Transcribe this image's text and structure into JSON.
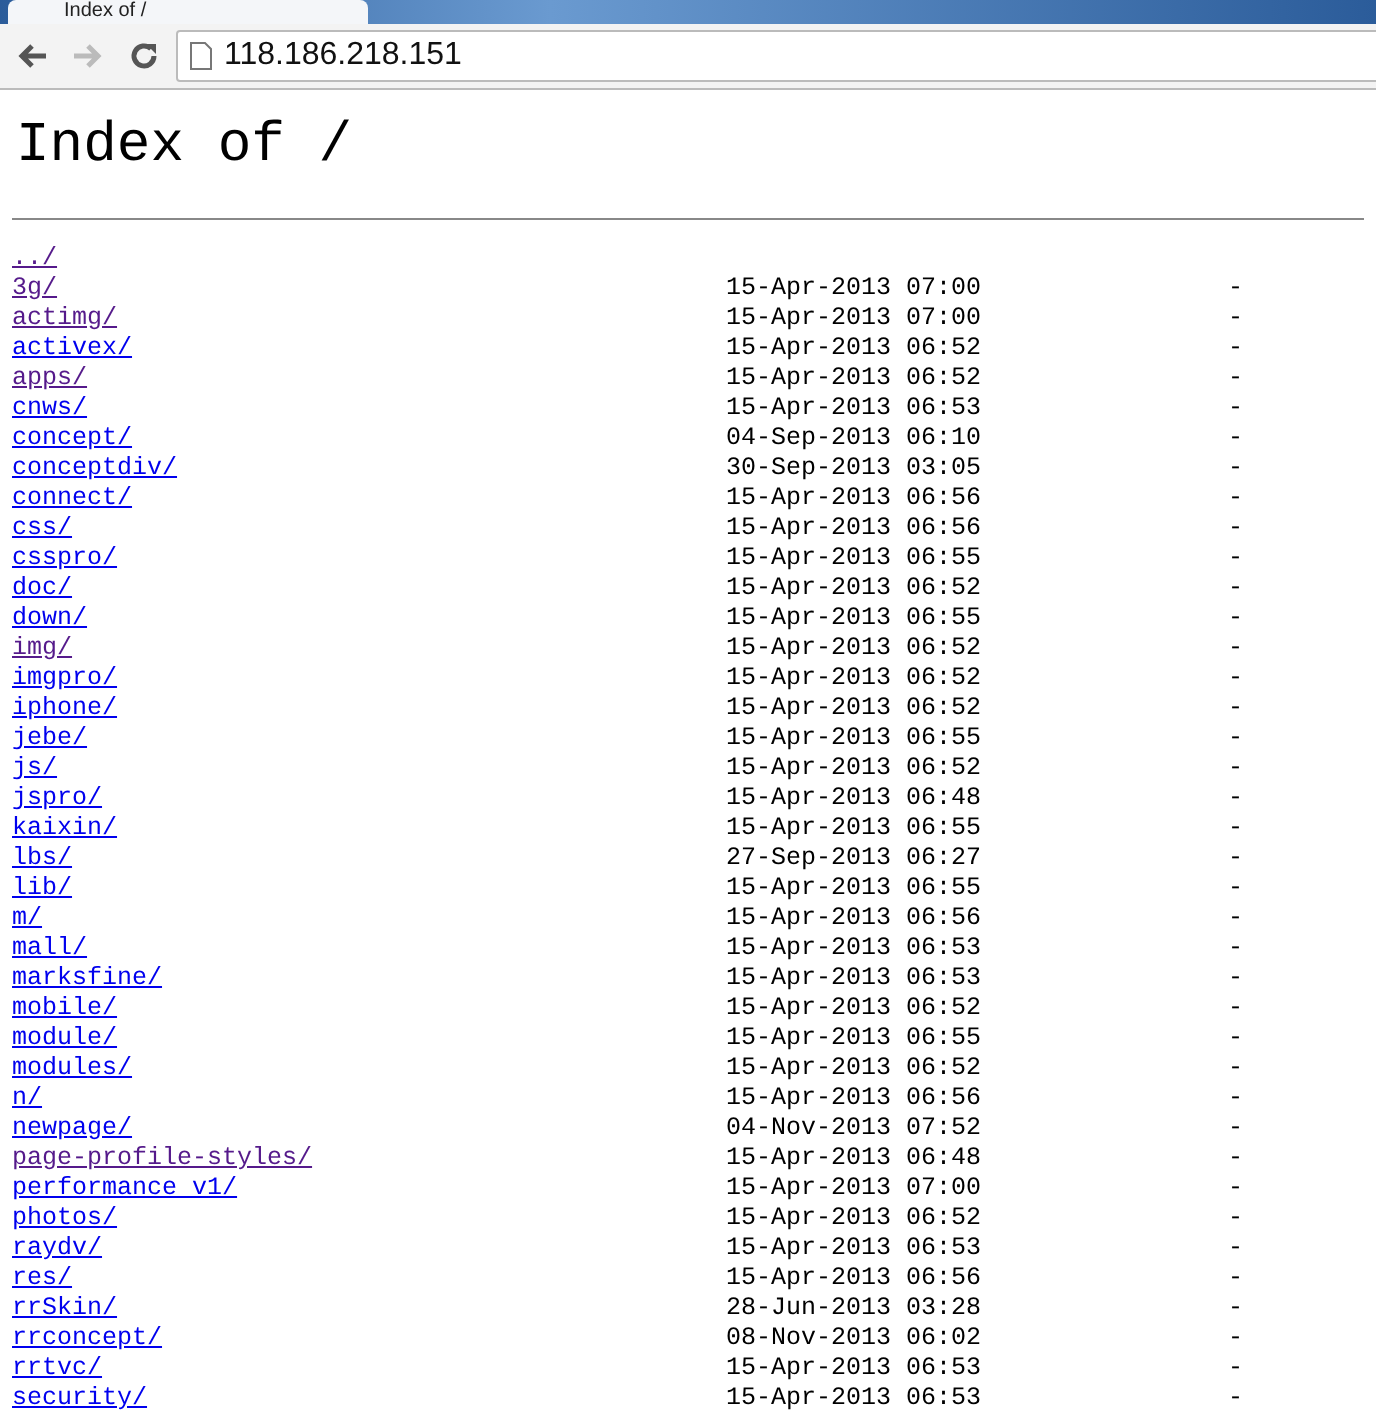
{
  "tab": {
    "title": "Index of /"
  },
  "toolbar": {
    "back_disabled": false,
    "forward_disabled": true,
    "address": "118.186.218.151"
  },
  "heading": "Index of /",
  "entries": [
    {
      "name": "../",
      "visited": true
    },
    {
      "name": "3g/",
      "visited": true,
      "modified": "15-Apr-2013 07:00",
      "size": "-"
    },
    {
      "name": "actimg/",
      "visited": true,
      "modified": "15-Apr-2013 07:00",
      "size": "-"
    },
    {
      "name": "activex/",
      "visited": false,
      "modified": "15-Apr-2013 06:52",
      "size": "-"
    },
    {
      "name": "apps/",
      "visited": true,
      "modified": "15-Apr-2013 06:52",
      "size": "-"
    },
    {
      "name": "cnws/",
      "visited": false,
      "modified": "15-Apr-2013 06:53",
      "size": "-"
    },
    {
      "name": "concept/",
      "visited": false,
      "modified": "04-Sep-2013 06:10",
      "size": "-"
    },
    {
      "name": "conceptdiv/",
      "visited": false,
      "modified": "30-Sep-2013 03:05",
      "size": "-"
    },
    {
      "name": "connect/",
      "visited": false,
      "modified": "15-Apr-2013 06:56",
      "size": "-"
    },
    {
      "name": "css/",
      "visited": false,
      "modified": "15-Apr-2013 06:56",
      "size": "-"
    },
    {
      "name": "csspro/",
      "visited": false,
      "modified": "15-Apr-2013 06:55",
      "size": "-"
    },
    {
      "name": "doc/",
      "visited": false,
      "modified": "15-Apr-2013 06:52",
      "size": "-"
    },
    {
      "name": "down/",
      "visited": false,
      "modified": "15-Apr-2013 06:55",
      "size": "-"
    },
    {
      "name": "img/",
      "visited": true,
      "modified": "15-Apr-2013 06:52",
      "size": "-"
    },
    {
      "name": "imgpro/",
      "visited": false,
      "modified": "15-Apr-2013 06:52",
      "size": "-"
    },
    {
      "name": "iphone/",
      "visited": false,
      "modified": "15-Apr-2013 06:52",
      "size": "-"
    },
    {
      "name": "jebe/",
      "visited": false,
      "modified": "15-Apr-2013 06:55",
      "size": "-"
    },
    {
      "name": "js/",
      "visited": false,
      "modified": "15-Apr-2013 06:52",
      "size": "-"
    },
    {
      "name": "jspro/",
      "visited": false,
      "modified": "15-Apr-2013 06:48",
      "size": "-"
    },
    {
      "name": "kaixin/",
      "visited": false,
      "modified": "15-Apr-2013 06:55",
      "size": "-"
    },
    {
      "name": "lbs/",
      "visited": false,
      "modified": "27-Sep-2013 06:27",
      "size": "-"
    },
    {
      "name": "lib/",
      "visited": false,
      "modified": "15-Apr-2013 06:55",
      "size": "-"
    },
    {
      "name": "m/",
      "visited": false,
      "modified": "15-Apr-2013 06:56",
      "size": "-"
    },
    {
      "name": "mall/",
      "visited": false,
      "modified": "15-Apr-2013 06:53",
      "size": "-"
    },
    {
      "name": "marksfine/",
      "visited": false,
      "modified": "15-Apr-2013 06:53",
      "size": "-"
    },
    {
      "name": "mobile/",
      "visited": false,
      "modified": "15-Apr-2013 06:52",
      "size": "-"
    },
    {
      "name": "module/",
      "visited": false,
      "modified": "15-Apr-2013 06:55",
      "size": "-"
    },
    {
      "name": "modules/",
      "visited": false,
      "modified": "15-Apr-2013 06:52",
      "size": "-"
    },
    {
      "name": "n/",
      "visited": false,
      "modified": "15-Apr-2013 06:56",
      "size": "-"
    },
    {
      "name": "newpage/",
      "visited": false,
      "modified": "04-Nov-2013 07:52",
      "size": "-"
    },
    {
      "name": "page-profile-styles/",
      "visited": true,
      "modified": "15-Apr-2013 06:48",
      "size": "-"
    },
    {
      "name": "performance v1/",
      "visited": false,
      "modified": "15-Apr-2013 07:00",
      "size": "-"
    },
    {
      "name": "photos/",
      "visited": false,
      "modified": "15-Apr-2013 06:52",
      "size": "-"
    },
    {
      "name": "raydv/",
      "visited": false,
      "modified": "15-Apr-2013 06:53",
      "size": "-"
    },
    {
      "name": "res/",
      "visited": false,
      "modified": "15-Apr-2013 06:56",
      "size": "-"
    },
    {
      "name": "rrSkin/",
      "visited": false,
      "modified": "28-Jun-2013 03:28",
      "size": "-"
    },
    {
      "name": "rrconcept/",
      "visited": false,
      "modified": "08-Nov-2013 06:02",
      "size": "-"
    },
    {
      "name": "rrtvc/",
      "visited": false,
      "modified": "15-Apr-2013 06:53",
      "size": "-"
    },
    {
      "name": "security/",
      "visited": false,
      "modified": "15-Apr-2013 06:53",
      "size": "-"
    }
  ]
}
